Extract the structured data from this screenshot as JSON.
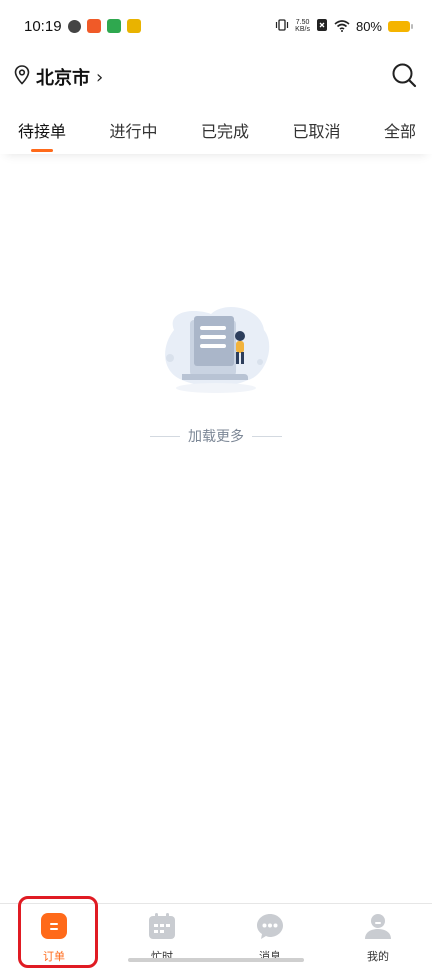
{
  "status_bar": {
    "time": "10:19",
    "net_speed_value": "7.50",
    "net_speed_unit": "KB/s",
    "battery_percent": "80%",
    "notification_icons": [
      "app-icon",
      "app-icon",
      "app-icon",
      "app-icon"
    ]
  },
  "header": {
    "city": "北京市",
    "city_chevron": "›"
  },
  "tabs": [
    {
      "label": "待接单",
      "active": true
    },
    {
      "label": "进行中",
      "active": false
    },
    {
      "label": "已完成",
      "active": false
    },
    {
      "label": "已取消",
      "active": false
    },
    {
      "label": "全部",
      "active": false
    }
  ],
  "empty_state": {
    "load_more": "加载更多"
  },
  "bottom_nav": [
    {
      "label": "订单",
      "icon": "order-icon",
      "active": true
    },
    {
      "label": "忙时",
      "icon": "calendar-icon",
      "active": false
    },
    {
      "label": "消息",
      "icon": "message-icon",
      "active": false
    },
    {
      "label": "我的",
      "icon": "profile-icon",
      "active": false
    }
  ],
  "colors": {
    "accent": "#ff6a1a",
    "highlight": "#e01b23",
    "battery": "#f5b400",
    "muted_text": "#7c8796",
    "nav_icon_gray": "#c9ccd1"
  }
}
